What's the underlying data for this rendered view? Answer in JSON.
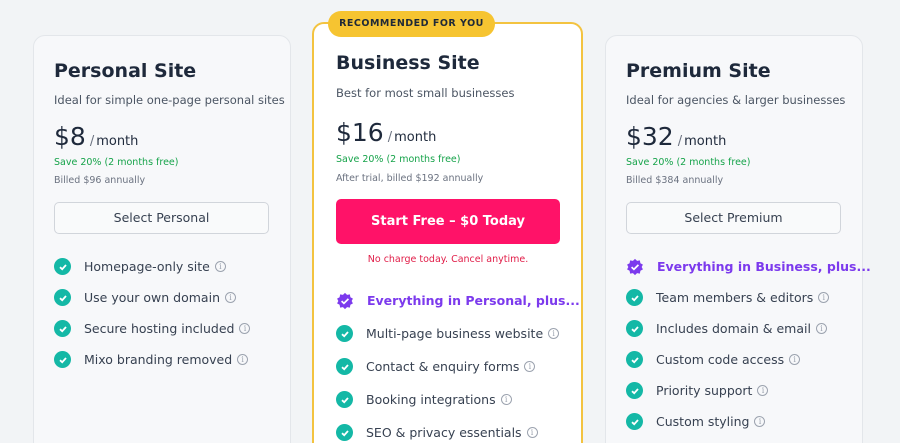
{
  "badge": "RECOMMENDED FOR YOU",
  "plans": [
    {
      "title": "Personal Site",
      "subtitle": "Ideal for simple one-page personal sites",
      "price": "$8",
      "period": "month",
      "save": "Save 20% (2 months free)",
      "billed": "Billed $96 annually",
      "button": "Select Personal",
      "features": [
        "Homepage-only site",
        "Use your own domain",
        "Secure hosting included",
        "Mixo branding removed"
      ]
    },
    {
      "title": "Business Site",
      "subtitle": "Best for most small businesses",
      "price": "$16",
      "period": "month",
      "save": "Save 20% (2 months free)",
      "billed": "After trial, billed $192 annually",
      "button": "Start Free – $0 Today",
      "note": "No charge today. Cancel anytime.",
      "highlight": "Everything in Personal, plus...",
      "features": [
        "Multi-page business website",
        "Contact & enquiry forms",
        "Booking integrations",
        "SEO & privacy essentials"
      ]
    },
    {
      "title": "Premium Site",
      "subtitle": "Ideal for agencies & larger businesses",
      "price": "$32",
      "period": "month",
      "save": "Save 20% (2 months free)",
      "billed": "Billed $384 annually",
      "button": "Select Premium",
      "highlight": "Everything in Business, plus...",
      "features": [
        "Team members & editors",
        "Includes domain & email",
        "Custom code access",
        "Priority support",
        "Custom styling"
      ]
    }
  ],
  "colors": {
    "accent": "#ff1268",
    "badge": "#f6c431",
    "check": "#14b8a6",
    "highlight": "#7c3aed",
    "save": "#16a34a"
  }
}
